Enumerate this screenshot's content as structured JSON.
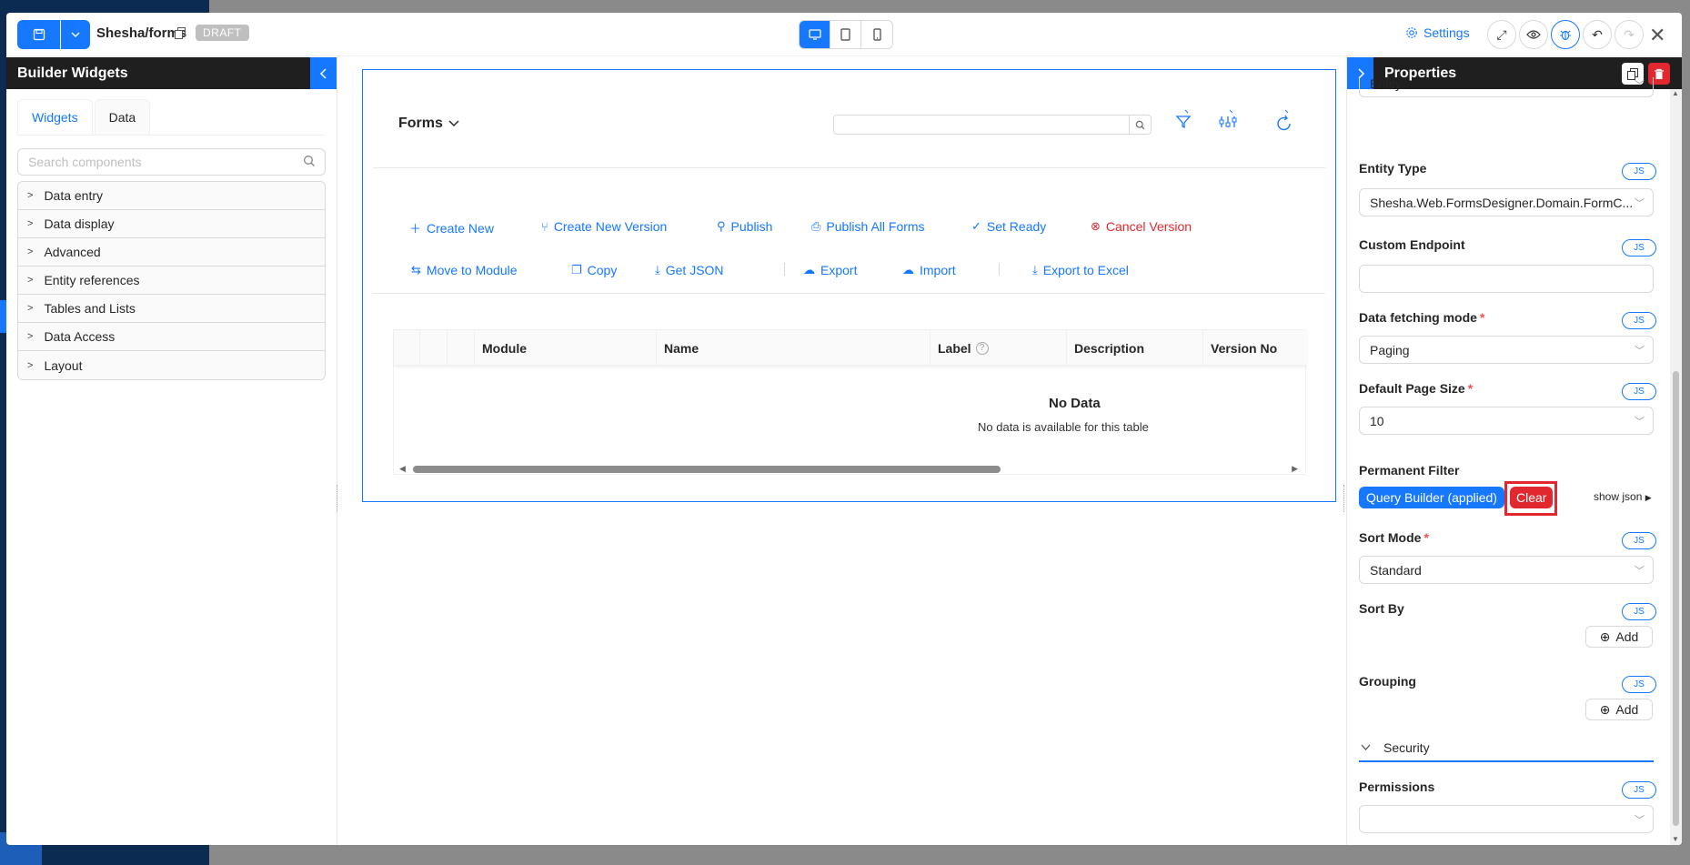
{
  "header": {
    "title": "Shesha/forms",
    "badge": "DRAFT",
    "settings_label": "Settings"
  },
  "left_panel": {
    "title": "Builder Widgets",
    "tabs": [
      "Widgets",
      "Data"
    ],
    "search_placeholder": "Search components",
    "categories": [
      "Data entry",
      "Data display",
      "Advanced",
      "Entity references",
      "Tables and Lists",
      "Data Access",
      "Layout"
    ]
  },
  "canvas": {
    "forms_title": "Forms",
    "toolbar_row1": [
      "Create New",
      "Create New Version",
      "Publish",
      "Publish All Forms",
      "Set Ready",
      "Cancel Version"
    ],
    "toolbar_row2": [
      "Move to Module",
      "Copy",
      "Get JSON",
      "Export",
      "Import",
      "Export to Excel"
    ],
    "table": {
      "columns": [
        "Module",
        "Name",
        "Label",
        "Description",
        "Version No"
      ],
      "empty_title": "No Data",
      "empty_subtitle": "No data is available for this table"
    }
  },
  "properties": {
    "title": "Properties",
    "partial_top_value": "Entity",
    "js_label": "JS",
    "fields": {
      "entity_type_label": "Entity Type",
      "entity_type_value": "Shesha.Web.FormsDesigner.Domain.FormC...",
      "custom_endpoint_label": "Custom Endpoint",
      "custom_endpoint_value": "",
      "data_fetching_label": "Data fetching mode",
      "data_fetching_value": "Paging",
      "page_size_label": "Default Page Size",
      "page_size_value": "10",
      "permanent_filter_label": "Permanent Filter",
      "query_builder_label": "Query Builder (applied)",
      "clear_label": "Clear",
      "show_json_label": "show json",
      "sort_mode_label": "Sort Mode",
      "sort_mode_value": "Standard",
      "sort_by_label": "Sort By",
      "add_label": "Add",
      "grouping_label": "Grouping",
      "security_label": "Security",
      "permissions_label": "Permissions",
      "permissions_value": ""
    },
    "required_mark": "*"
  },
  "colors": {
    "primary": "#1677ff",
    "danger": "#e0282e",
    "panel_header": "#1f1f1f"
  }
}
